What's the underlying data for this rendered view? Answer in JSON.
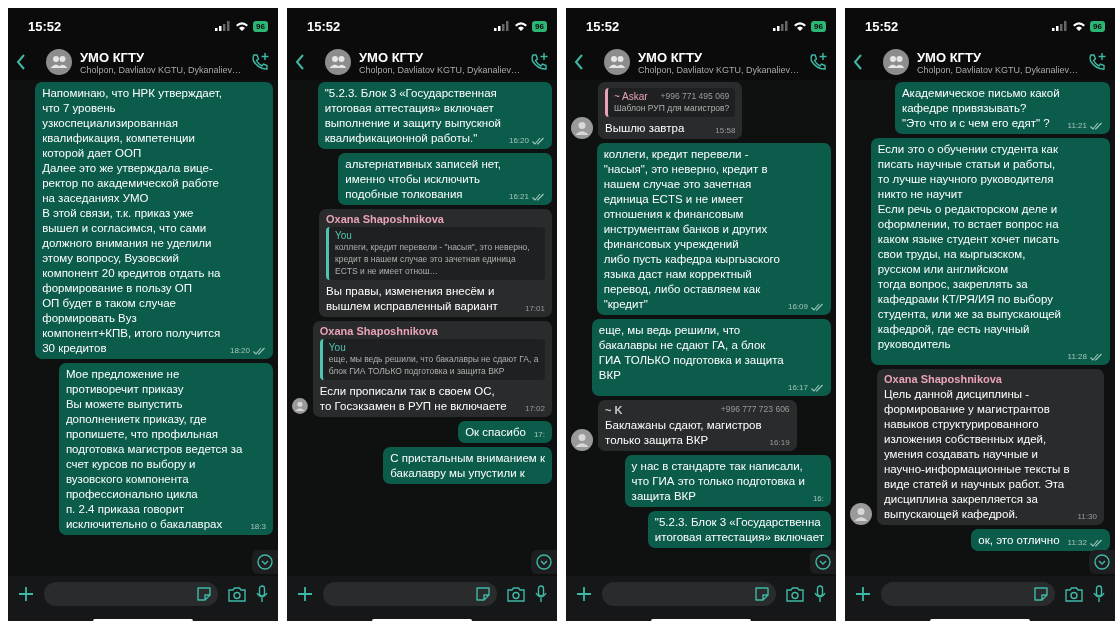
{
  "phones": [
    {
      "status": {
        "time": "15:52",
        "battery": "96"
      },
      "header": {
        "title": "УМО КГТУ",
        "subtitle": "Cholpon, Davliatov KGTU, Dykanaliev…"
      },
      "messages": [
        {
          "kind": "out",
          "text": "Напоминаю, что НРК утверждает,\nчто 7 уровень\nузкоспециализированная\nквалификация, компетенции\nкоторой дает ООП\nДалее это же утверждала вице-\nректор по академической работе\nна заседаниях УМО\nВ этой связи, т.к. приказ уже\nвышел и согласимся, что сами\nдолжного внимания не уделили\nэтому вопросу, Вузовский\nкомпонент 20 кредитов отдать на\nформирование в пользу ОП\nОП будет в таком случае\nформировать Вуз\nкомпонент+КПВ, итого получится\n30 кредитов",
          "time": "18:20",
          "read": true
        },
        {
          "kind": "out",
          "text": "Мое предложение не\nпротиворечит приказу\nВы можете выпустить\nдополнениетк приказу, где\nпропишете, что профильная\nподготовка магистров ведется за\nсчет курсов по выбору и\nвузовского компонента\nпрофессионально цикла\nп. 2.4 приказа говорит\nисключительно о бакалаврах",
          "time": "18:3",
          "read": false
        }
      ]
    },
    {
      "status": {
        "time": "15:52",
        "battery": "96"
      },
      "header": {
        "title": "УМО КГТУ",
        "subtitle": "Cholpon, Davliatov KGTU, Dykanaliev…"
      },
      "messages": [
        {
          "kind": "out",
          "text": "\"5.2.3. Блок 3 «Государственная\nитоговая аттестация» включает\nвыполнение и защиту выпускной\nквалификационной работы.\"",
          "time": "16:20",
          "read": true
        },
        {
          "kind": "out",
          "text": "альтернативных записей нет,\nименно чтобы исключить\nподобные толкования",
          "time": "16:21",
          "read": true
        },
        {
          "kind": "in",
          "sender": {
            "name": "Oxana Shaposhnikova",
            "color": "#e8a3b6"
          },
          "quote": {
            "author": "You",
            "color": "#4fc4b0",
            "text": "коллеги, кредит перевели - \"насыя\", это неверно, кредит в нашем случае это зачетная единица ECTS и не имеет отнош…"
          },
          "text": "Вы правы, изменения внесём и\nвышлем исправленный вариант",
          "time": "17:01",
          "avatar": false
        },
        {
          "kind": "in",
          "sender": {
            "name": "Oxana Shaposhnikova",
            "color": "#e8a3b6"
          },
          "quote": {
            "author": "You",
            "color": "#4fc4b0",
            "text": "еще, мы ведь решили, что бакалавры не сдают ГА, а блок ГИА ТОЛЬКО подготовка и защита ВКР"
          },
          "text": "Если прописали так в своем ОС,\nто Госэкзамен в РУП не включаете",
          "time": "17:02",
          "avatar": true
        },
        {
          "kind": "out",
          "text": "Ок спасибо",
          "time": "17:",
          "read": false
        },
        {
          "kind": "out",
          "text": "С пристальным вниманием к\nбакалавру мы упустили к"
        }
      ]
    },
    {
      "status": {
        "time": "15:52",
        "battery": "96"
      },
      "header": {
        "title": "УМО КГТУ",
        "subtitle": "Cholpon, Davliatov KGTU, Dykanaliev…"
      },
      "messages": [
        {
          "kind": "in",
          "quote": {
            "author": "~ Askar",
            "phone": "+996 771 495 069",
            "color": "#e8a3b6",
            "text": "Шаблон РУП для магистров?"
          },
          "text": "Вышлю завтра",
          "time": "15:58",
          "avatar": true
        },
        {
          "kind": "out",
          "text": "коллеги, кредит перевели -\n\"насыя\", это неверно, кредит в\nнашем случае это зачетная\nединица ECTS и не имеет\nотношения к финансовым\nинструментам банков и других\nфинансовых учреждений\nлибо пусть кафедра кыргызского\nязыка даст нам корректный\nперевод, либо оставляем как\n\"кредит\"",
          "time": "16:09",
          "read": true
        },
        {
          "kind": "out",
          "text": "еще, мы ведь решили, что\nбакалавры не сдают ГА, а блок\nГИА ТОЛЬКО подготовка и защита\nВКР",
          "time": "16:17",
          "read": true
        },
        {
          "kind": "in",
          "sender": {
            "name": "~ K",
            "phone": "+996 777 723 606",
            "color": "#c8c8c8"
          },
          "text": "Баклажаны сдают, магистров\nтолько защита ВКР",
          "time": "16:19",
          "avatar": true
        },
        {
          "kind": "out",
          "text": "у нас в стандарте так написали,\nчто ГИА это только подготовка и\nзащита ВКР",
          "time": "16:",
          "read": false
        },
        {
          "kind": "out",
          "text": "\"5.2.3. Блок 3 «Государственна\nитоговая аттестация» включает"
        }
      ]
    },
    {
      "status": {
        "time": "15:52",
        "battery": "96"
      },
      "header": {
        "title": "УМО КГТУ",
        "subtitle": "Cholpon, Davliatov KGTU, Dykanaliev…"
      },
      "messages": [
        {
          "kind": "out",
          "text": "Академическое письмо какой\nкафедре привязывать?\n\"Это что и с чем его едят\" ?",
          "time": "11:21",
          "read": true
        },
        {
          "kind": "out",
          "text": "Если это о обучении студента как\nписать научные статьи и работы,\nто лучше научного руководителя\nникто не научит\nЕсли речь о редакторском деле и\nоформлении, то встает вопрос на\nкаком языке студент хочет писать\nсвои труды, на кыргызском,\nрусском или английском\nтогда вопрос, закреплять за\nкафедрами КТ/РЯ/ИЯ по выбору\nстудента, или же за выпускающей\nкафедрой, где есть научный\nруководитель",
          "time": "11:28",
          "read": true
        },
        {
          "kind": "in",
          "sender": {
            "name": "Oxana Shaposhnikova",
            "color": "#e8a3b6"
          },
          "text": "Цель данной дисциплины -\nформирование у магистрантов\nнавыков структурированного\nизложения собственных идей,\nумения создавать научные и\nнаучно-информационные тексты в\nвиде статей и научных работ. Эта\nдисциплина закрепляется за\nвыпускающей кафедрой.",
          "time": "11:30",
          "avatar": true
        },
        {
          "kind": "out",
          "text": "ок, это отлично",
          "time": "11:32",
          "read": true
        }
      ]
    }
  ]
}
